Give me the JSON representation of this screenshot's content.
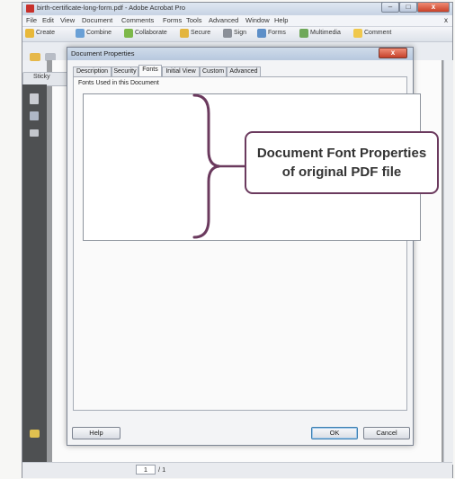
{
  "window": {
    "title": "birth-certificate-long-form.pdf - Adobe Acrobat Pro",
    "min_glyph": "–",
    "max_glyph": "□",
    "close_glyph": "x"
  },
  "menu": {
    "items": [
      "File",
      "Edit",
      "View",
      "Document",
      "Comments",
      "Forms",
      "Tools",
      "Advanced",
      "Window",
      "Help"
    ],
    "close_glyph": "x"
  },
  "toolbar": {
    "items": [
      "Create",
      "Combine",
      "Collaborate",
      "Secure",
      "Sign",
      "Forms",
      "Multimedia",
      "Comment"
    ]
  },
  "side": {
    "sticky_label": "Sticky"
  },
  "dialog": {
    "title": "Document Properties",
    "close_glyph": "x",
    "tabs": [
      "Description",
      "Security",
      "Fonts",
      "Initial View",
      "Custom",
      "Advanced"
    ],
    "active_tab": "Fonts",
    "fonts_heading": "Fonts Used in this Document",
    "help_label": "Help",
    "ok_label": "OK",
    "cancel_label": "Cancel"
  },
  "annotation": {
    "line1": "Document Font Properties",
    "line2": "of original PDF file",
    "color": "#6b3a5e"
  },
  "status": {
    "page_number": "1",
    "page_total": "/ 1"
  }
}
